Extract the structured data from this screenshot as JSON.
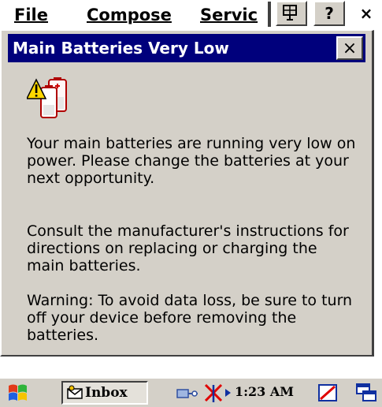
{
  "menubar": {
    "items": [
      "File",
      "Compose",
      "Servic"
    ],
    "buttons": {
      "help": "?",
      "close": "×"
    }
  },
  "dialog": {
    "title": "Main Batteries Very Low",
    "close": "×",
    "icon": "battery-warning-icon",
    "paragraphs": [
      "Your main batteries are running very low on power. Please change the batteries at your next opportunity.",
      "Consult the manufacturer's instructions for directions on replacing or charging the main batteries.",
      "Warning: To avoid data loss, be sure to turn off your device before removing the batteries."
    ]
  },
  "taskbar": {
    "inbox_label": "Inbox",
    "time": "1:23 AM",
    "icons": [
      "start-icon",
      "inbox-icon",
      "network-icon",
      "antenna-icon",
      "battery-icon",
      "windows-icon"
    ]
  },
  "colors": {
    "title_bar": "#00007c",
    "dialog_bg": "#d4d0c8",
    "warning_yellow": "#ffd800"
  }
}
